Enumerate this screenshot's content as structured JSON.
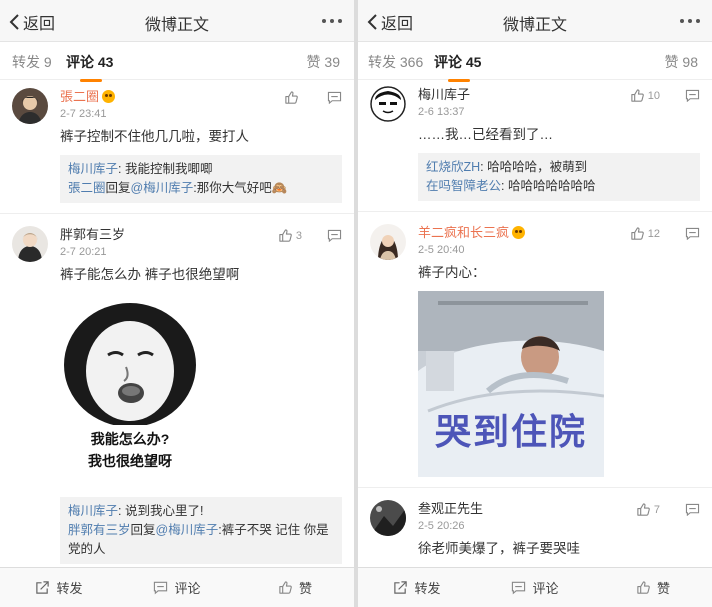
{
  "left": {
    "back": "返回",
    "title": "微博正文",
    "tabs": {
      "repost": "转发 9",
      "comment": "评论 43",
      "like": "赞 39"
    },
    "comments": [
      {
        "name": "張二圈",
        "time": "2-7 23:41",
        "text": "裤子控制不住他几几啦，要打人",
        "replies": [
          {
            "user": "梅川库子",
            "text": ": 我能控制我唧唧"
          },
          {
            "user": "張二圈",
            "mid": "回复",
            "to": "@梅川库子",
            "text": ":那你大气好吧🙈"
          }
        ]
      },
      {
        "name": "胖郭有三岁",
        "time": "2-7 20:21",
        "likes": "3",
        "text": "裤子能怎么办 裤子也很绝望啊",
        "meme": [
          "我能怎么办?",
          "我也很绝望呀"
        ],
        "replies": [
          {
            "user": "梅川库子",
            "text": ": 说到我心里了!"
          },
          {
            "user": "胖郭有三岁",
            "mid": "回复",
            "to": "@梅川库子",
            "text": ":裤子不哭 记住 你是党的人"
          }
        ]
      }
    ],
    "bottom": {
      "repost": "转发",
      "comment": "评论",
      "like": "赞"
    }
  },
  "right": {
    "back": "返回",
    "title": "微博正文",
    "tabs": {
      "repost": "转发 366",
      "comment": "评论 45",
      "like": "赞 98"
    },
    "comments": [
      {
        "name": "梅川库子",
        "time": "2-6 13:37",
        "likes": "10",
        "text": "……我…已经看到了…",
        "replies": [
          {
            "user": "红烧欣ZH",
            "text": ": 哈哈哈哈，被萌到"
          },
          {
            "user": "在吗智障老公",
            "text": ": 哈哈哈哈哈哈哈"
          }
        ]
      },
      {
        "name": "羊二疯和长三疯",
        "time": "2-5 20:40",
        "likes": "12",
        "text": "裤子内心：",
        "photo_caption": "哭到住院"
      },
      {
        "name": "叁观正先生",
        "time": "2-5 20:26",
        "likes": "7",
        "text": "徐老师美爆了，裤子要哭哇"
      }
    ],
    "bottom": {
      "repost": "转发",
      "comment": "评论",
      "like": "赞"
    }
  },
  "colors": {
    "accent": "#ff8200",
    "link": "#507daf",
    "vip_name": "#eb7350"
  }
}
